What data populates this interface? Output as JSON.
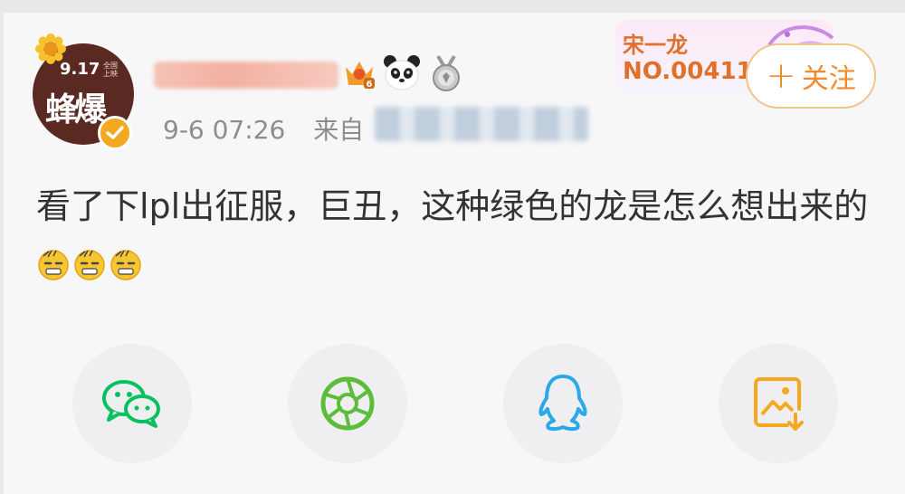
{
  "avatar": {
    "poster_date": "9.17",
    "poster_sub": "全国\n上映",
    "poster_title": "蜂爆"
  },
  "post": {
    "time": "9-6 07:26",
    "from_label": "来自",
    "text": "看了下lpl出征服，巨丑，这种绿色的龙是怎么想出来的"
  },
  "decoration": {
    "name": "宋一龙",
    "number": "NO.004111"
  },
  "follow": {
    "plus": "+",
    "label": "关注"
  },
  "icons": {
    "verified": "verified-badge-icon",
    "level_badge": "crown-level-badge-icon",
    "panda": "panda-icon",
    "medal": "medal-icon",
    "emoji": "grimace-emoji",
    "share": [
      "wechat-icon",
      "moments-icon",
      "qq-icon",
      "save-image-icon"
    ]
  },
  "colors": {
    "accent_orange": "#f08a2a",
    "wechat_green": "#07c160",
    "moments_green": "#5cbd3c",
    "qq_blue": "#2aa8e8",
    "save_orange": "#f3a81f"
  }
}
